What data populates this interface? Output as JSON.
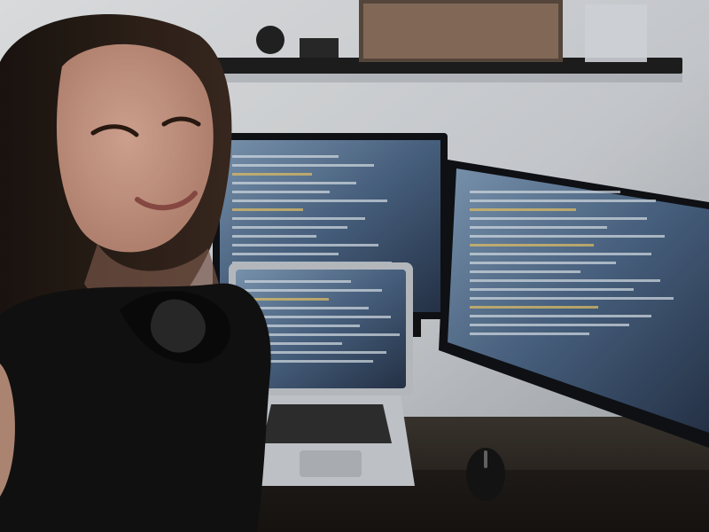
{
  "scene": {
    "palette": {
      "wall": "#cfd2d6",
      "wall_shadow": "#9aa0a6",
      "shelf": "#1e1e1e",
      "screen_dark": "#27344a",
      "screen_light": "#6f8aa6",
      "code_light": "#d8e2ea",
      "code_accent": "#e8c76a",
      "hair": "#2b1f18",
      "skin": "#c99a85",
      "shirt": "#111111",
      "laptop": "#bfc3c7",
      "desk": "#3a332c"
    },
    "objects": [
      "wall-shelf",
      "photo-frame",
      "monitor-left",
      "monitor-right",
      "laptop",
      "keyboard-laptop",
      "mouse",
      "desk",
      "person"
    ]
  }
}
